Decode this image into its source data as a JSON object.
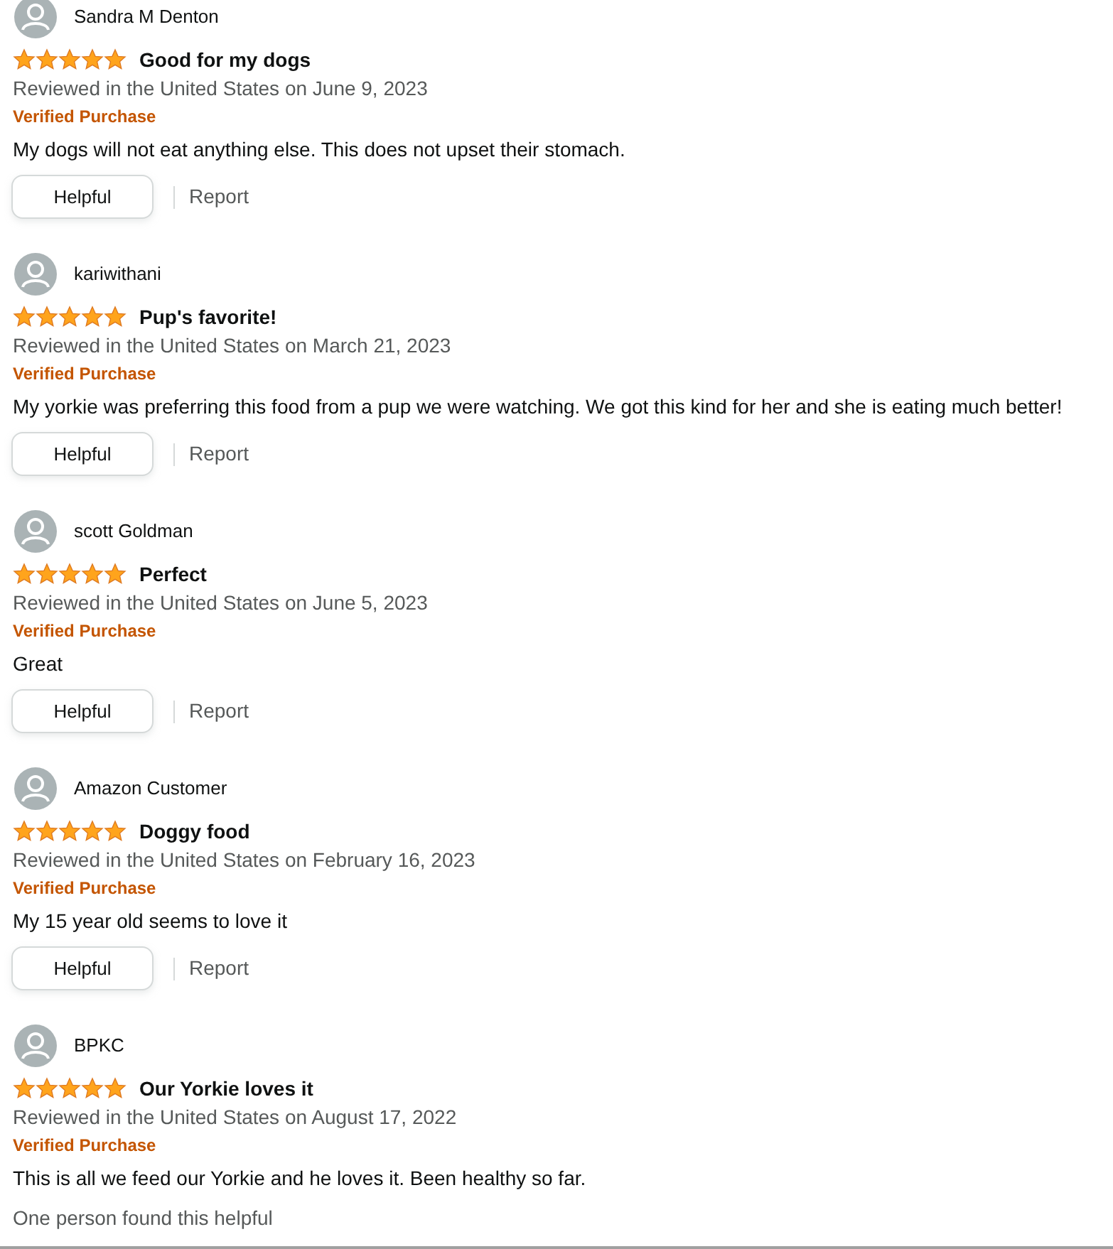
{
  "reviews": [
    {
      "author": "Sandra M Denton",
      "stars": 5,
      "title": "Good for my dogs",
      "meta": "Reviewed in the United States on June 9, 2023",
      "verified": "Verified Purchase",
      "body": "My dogs will not eat anything else. This does not upset their stomach.",
      "helpful_button": "Helpful",
      "report_link": "Report"
    },
    {
      "author": "kariwithani",
      "stars": 5,
      "title": "Pup's favorite!",
      "meta": "Reviewed in the United States on March 21, 2023",
      "verified": "Verified Purchase",
      "body": "My yorkie was preferring this food from a pup we were watching. We got this kind for her and she is eating much better!",
      "helpful_button": "Helpful",
      "report_link": "Report"
    },
    {
      "author": "scott Goldman",
      "stars": 5,
      "title": "Perfect",
      "meta": "Reviewed in the United States on June 5, 2023",
      "verified": "Verified Purchase",
      "body": "Great",
      "helpful_button": "Helpful",
      "report_link": "Report"
    },
    {
      "author": "Amazon Customer",
      "stars": 5,
      "title": "Doggy food",
      "meta": "Reviewed in the United States on February 16, 2023",
      "verified": "Verified Purchase",
      "body": "My 15 year old seems to love it",
      "helpful_button": "Helpful",
      "report_link": "Report"
    },
    {
      "author": "BPKC",
      "stars": 5,
      "title": "Our Yorkie loves it",
      "meta": "Reviewed in the United States on August 17, 2022",
      "verified": "Verified Purchase",
      "body": "This is all we feed our Yorkie and he loves it. Been healthy so far.",
      "helpful_count": "One person found this helpful"
    }
  ]
}
